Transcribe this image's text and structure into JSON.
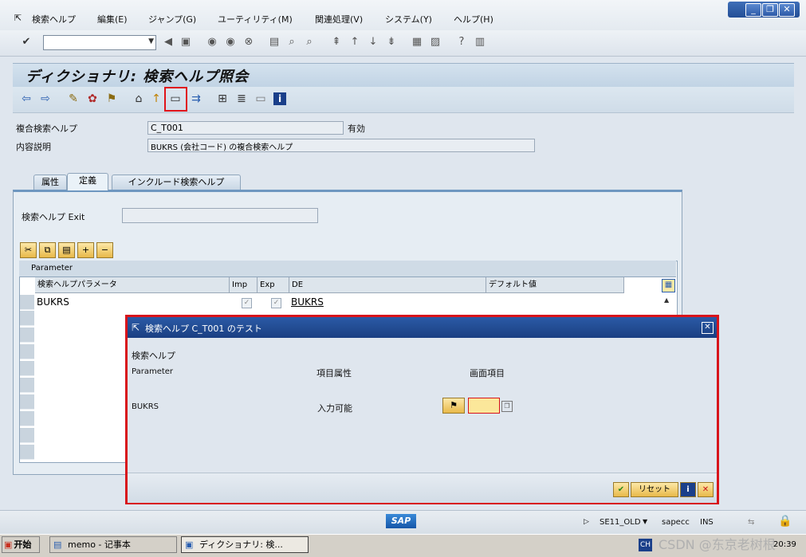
{
  "menu": {
    "items": [
      "検索ヘルプ",
      "編集(E)",
      "ジャンプ(G)",
      "ユーティリティ(M)",
      "関連処理(V)",
      "システム(Y)",
      "ヘルプ(H)"
    ]
  },
  "window": {
    "title": "ディクショナリ: 検索ヘルプ照会"
  },
  "fields": {
    "search_help_label": "複合検索ヘルプ",
    "search_help_value": "C_T001",
    "status": "有効",
    "description_label": "内容説明",
    "description_value": "BUKRS (会社コード) の複合検索ヘルプ"
  },
  "tabs": [
    "属性",
    "定義",
    "インクルード検索ヘルプ"
  ],
  "exit": {
    "label": "検索ヘルプ Exit",
    "value": ""
  },
  "table": {
    "title": "Parameter",
    "headers": [
      "検索ヘルプパラメータ",
      "Imp",
      "Exp",
      "DE",
      "デフォルト値"
    ],
    "rows": [
      {
        "param": "BUKRS",
        "imp": true,
        "exp": true,
        "de": "BUKRS",
        "default": ""
      }
    ]
  },
  "dialog": {
    "title": "検索ヘルプ C_T001 のテスト",
    "heading": "検索ヘルプ",
    "col_parameter": "Parameter",
    "col_attr": "項目属性",
    "col_screen": "画面項目",
    "row_param": "BUKRS",
    "row_attr": "入力可能",
    "row_value": "",
    "reset_label": "リセット"
  },
  "status": {
    "transaction": "SE11_OLD",
    "server": "sapecc",
    "mode": "INS",
    "brand": "SAP"
  },
  "taskbar": {
    "start": "开始",
    "task1": "memo - 记事本",
    "task2": "ディクショナリ: 検...",
    "lang": "CH",
    "time": "20:39",
    "watermark": "CSDN @东京老树根"
  },
  "colors": {
    "dialog_border": "#d8141b",
    "title_blue": "#1a3f82",
    "accent_yellow": "#e8b94a"
  }
}
